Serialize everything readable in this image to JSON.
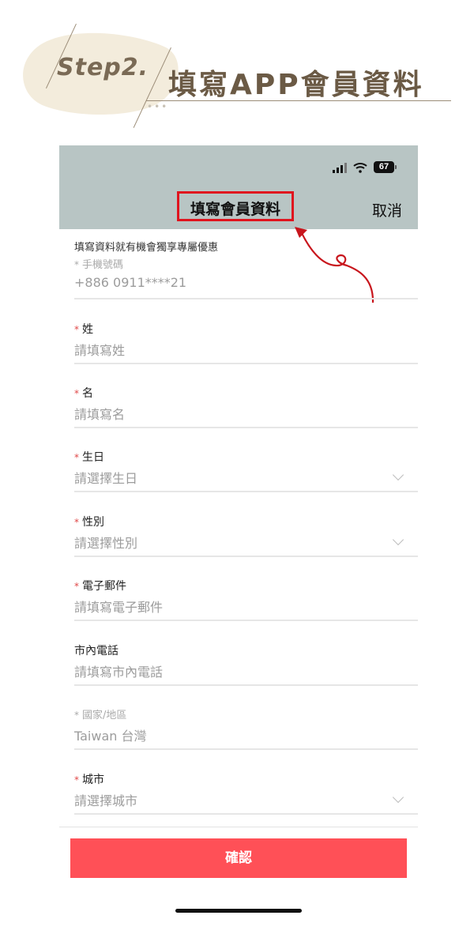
{
  "step": {
    "label": "Step2.",
    "title": "填寫APP會員資料"
  },
  "status_bar": {
    "battery": "67"
  },
  "header": {
    "title": "填寫會員資料",
    "cancel_label": "取消"
  },
  "promo_text": "填寫資料就有機會獨享專屬優惠",
  "fields": [
    {
      "label": "手機號碼",
      "value": "+886 0911****21",
      "required": true,
      "disabled": true,
      "dropdown": false
    },
    {
      "label": "姓",
      "value": "請填寫姓",
      "required": true,
      "disabled": false,
      "dropdown": false
    },
    {
      "label": "名",
      "value": "請填寫名",
      "required": true,
      "disabled": false,
      "dropdown": false
    },
    {
      "label": "生日",
      "value": "請選擇生日",
      "required": true,
      "disabled": false,
      "dropdown": true
    },
    {
      "label": "性別",
      "value": "請選擇性別",
      "required": true,
      "disabled": false,
      "dropdown": true
    },
    {
      "label": "電子郵件",
      "value": "請填寫電子郵件",
      "required": true,
      "disabled": false,
      "dropdown": false
    },
    {
      "label": "市內電話",
      "value": "請填寫市內電話",
      "required": false,
      "disabled": false,
      "dropdown": false
    },
    {
      "label": "國家/地區",
      "value": "Taiwan 台灣",
      "required": true,
      "disabled": true,
      "dropdown": false
    },
    {
      "label": "城市",
      "value": "請選擇城市",
      "required": true,
      "disabled": false,
      "dropdown": true
    }
  ],
  "required_mark": "*",
  "confirm_label": "確認",
  "colors": {
    "accent": "#ff5057",
    "header_bg": "#b8c5c4",
    "highlight": "#e0141e",
    "step_text": "#6b5a45"
  },
  "icons": [
    "signal-icon",
    "wifi-icon",
    "battery-icon",
    "chevron-down-icon",
    "annotation-arrow-icon"
  ]
}
